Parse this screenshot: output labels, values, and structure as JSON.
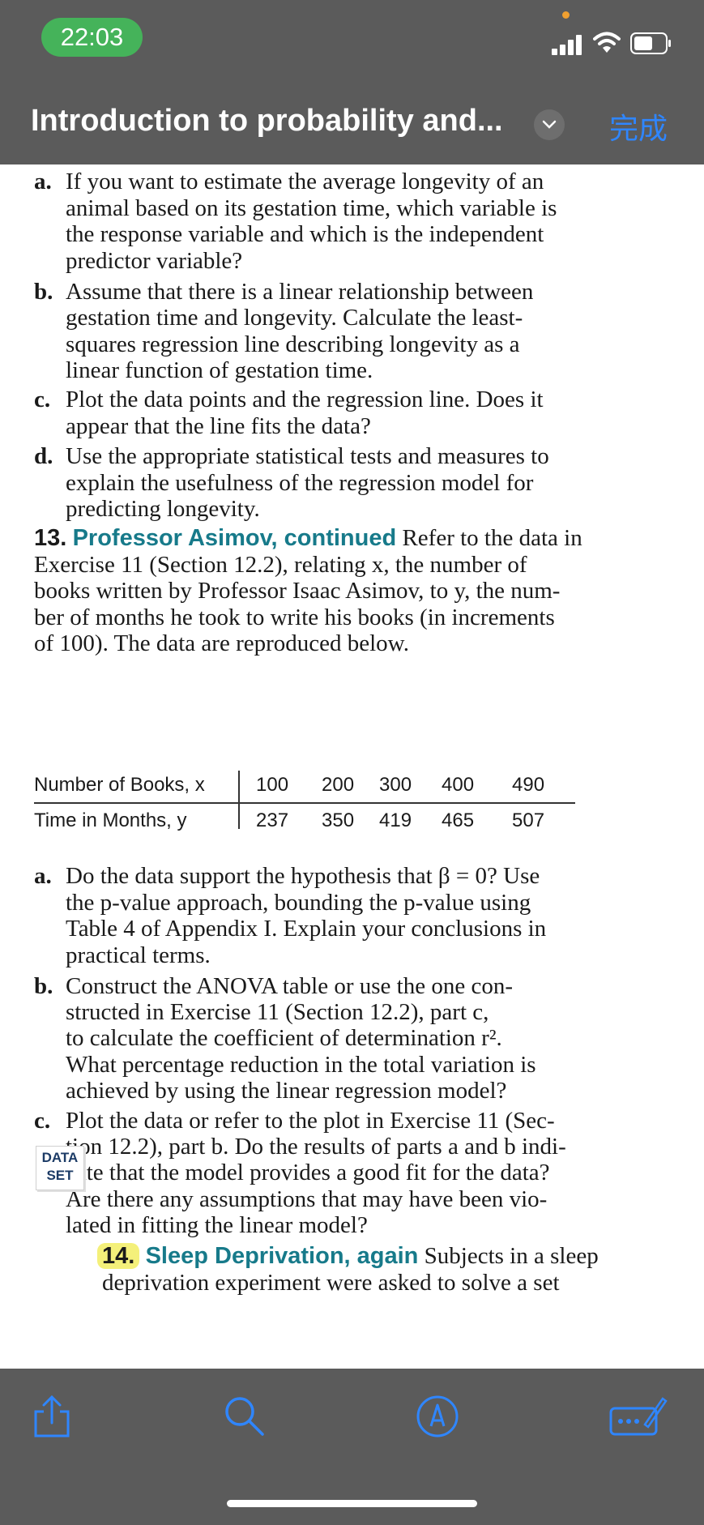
{
  "status_bar": {
    "time": "22:03"
  },
  "nav": {
    "title": "Introduction to probability and...",
    "done_label": "完成"
  },
  "colors": {
    "bar_bg": "#5b5b5b",
    "time_pill": "#45b35a",
    "accent": "#2f86ff",
    "exercise_heading": "#177a8a",
    "highlight": "#f4f07a"
  },
  "ex12_parts": [
    {
      "label": "a.",
      "lines": [
        "If you want to estimate the average longevity of an",
        "animal based on its gestation time, which variable is",
        "the response variable and which is the independent",
        "predictor variable?"
      ]
    },
    {
      "label": "b.",
      "lines": [
        "Assume that there is a linear relationship between",
        "gestation time and longevity. Calculate the least-",
        "squares regression line describing longevity as a",
        "linear function of gestation time."
      ]
    },
    {
      "label": "c.",
      "lines": [
        "Plot the data points and the regression line. Does it",
        "appear that the line fits the data?"
      ]
    },
    {
      "label": "d.",
      "lines": [
        "Use the appropriate statistical tests and measures to",
        "explain the usefulness of the regression model for",
        "predicting longevity."
      ]
    }
  ],
  "ex13": {
    "number": "13.",
    "heading": "Professor Asimov, continued",
    "lines": [
      "Refer to the data in",
      "Exercise 11 (Section 12.2), relating x, the number of",
      "books written by Professor Isaac Asimov, to y, the num-",
      "ber of months he took to write his books (in increments",
      "of 100). The data are reproduced below."
    ],
    "table": {
      "row1_label": "Number of Books, x",
      "row1_values": [
        "100",
        "200",
        "300",
        "400",
        "490"
      ],
      "row2_label": "Time in Months, y",
      "row2_values": [
        "237",
        "350",
        "419",
        "465",
        "507"
      ]
    },
    "parts": [
      {
        "label": "a.",
        "lines": [
          "Do the data support the hypothesis that β = 0? Use",
          "the p-value approach, bounding the p-value using",
          "Table 4 of Appendix I. Explain your conclusions in",
          "practical terms."
        ]
      },
      {
        "label": "b.",
        "lines": [
          "Construct the ANOVA table or use the one con-",
          "structed in Exercise 11 (Section 12.2), part c,",
          "to calculate the coefficient of determination r².",
          "What percentage reduction in the total variation is",
          "achieved by using the linear regression model?"
        ]
      },
      {
        "label": "c.",
        "lines": [
          "Plot the data or refer to the plot in Exercise 11 (Sec-",
          "tion 12.2), part b. Do the results of parts a and b indi-",
          "cate that the model provides a good fit for the data?",
          "Are there any assumptions that may have been vio-",
          "lated in fitting the linear model?"
        ]
      }
    ]
  },
  "ex14": {
    "badge_line1": "DATA",
    "badge_line2": "SET",
    "number": "14.",
    "heading": "Sleep Deprivation, again",
    "lines": [
      "Subjects in a sleep",
      "deprivation experiment were asked to solve a set"
    ]
  },
  "toolbar": {
    "icons": [
      "share-icon",
      "search-icon",
      "markup-icon",
      "keyboard-edit-icon"
    ]
  }
}
